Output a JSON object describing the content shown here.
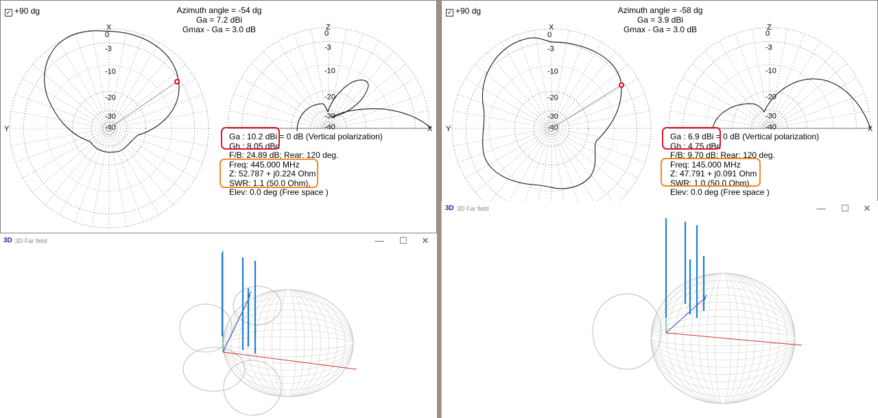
{
  "left": {
    "checkbox_label": "+90 dg",
    "header": {
      "azimuth": "Azimuth angle = -54 dg",
      "ga": "Ga = 7.2 dBi",
      "gmax": "Gmax - Ga = 3.0 dB"
    },
    "axis": {
      "top_left": "X",
      "top_right": "Z",
      "left": "Y",
      "right": "X"
    },
    "rings": [
      "0",
      "-3",
      "-10",
      "-20",
      "-30",
      "-40"
    ],
    "info": {
      "ga": "Ga : 10.2 dBi = 0 dB  (Vertical polarization)",
      "gh": "Gh : 8.05 dBd",
      "fb": "F/B: 24.89 dB; Rear: 120 deg.",
      "freq": "Freq: 445.000 MHz",
      "z": "Z: 52.787 + j0.224 Ohm",
      "swr": "SWR: 1.1 (50.0 Ohm),",
      "elev": "Elev: 0.0 deg (Free space )"
    },
    "farfield": {
      "title": "3D Far field",
      "logo": "3D",
      "axis_y": "Y"
    }
  },
  "right": {
    "checkbox_label": "+90 dg",
    "header": {
      "azimuth": "Azimuth angle = -58 dg",
      "ga": "Ga = 3.9 dBi",
      "gmax": "Gmax - Ga = 3.0 dB"
    },
    "axis": {
      "top_left": "X",
      "top_right": "Z",
      "left": "Y",
      "right": "X"
    },
    "rings": [
      "0",
      "-3",
      "-10",
      "-20",
      "-30",
      "-40"
    ],
    "info": {
      "ga": "Ga : 6.9 dBi = 0 dB  (Vertical polarization)",
      "gh": "Gh : 4.75 dBd",
      "fb": "F/B: 9.70 dB; Rear: 120 deg.",
      "freq": "Freq: 145.000 MHz",
      "z": "Z: 47.791 + j0.091 Ohm",
      "swr": "SWR: 1.0 (50.0 Ohm),",
      "elev": "Elev: 0.0 deg (Free space )"
    },
    "farfield": {
      "title": "3D Far field",
      "logo": "3D",
      "axis_y": "Y"
    }
  },
  "window_controls": {
    "minimize": "—",
    "maximize": "☐",
    "close": "✕"
  },
  "colors": {
    "highlight_red": "#d6182b",
    "highlight_orange": "#f08a24",
    "pattern_line": "#000000",
    "marker": "#e0001a",
    "wire": "#1f7fd0",
    "mesh": "#bdbdbd"
  }
}
